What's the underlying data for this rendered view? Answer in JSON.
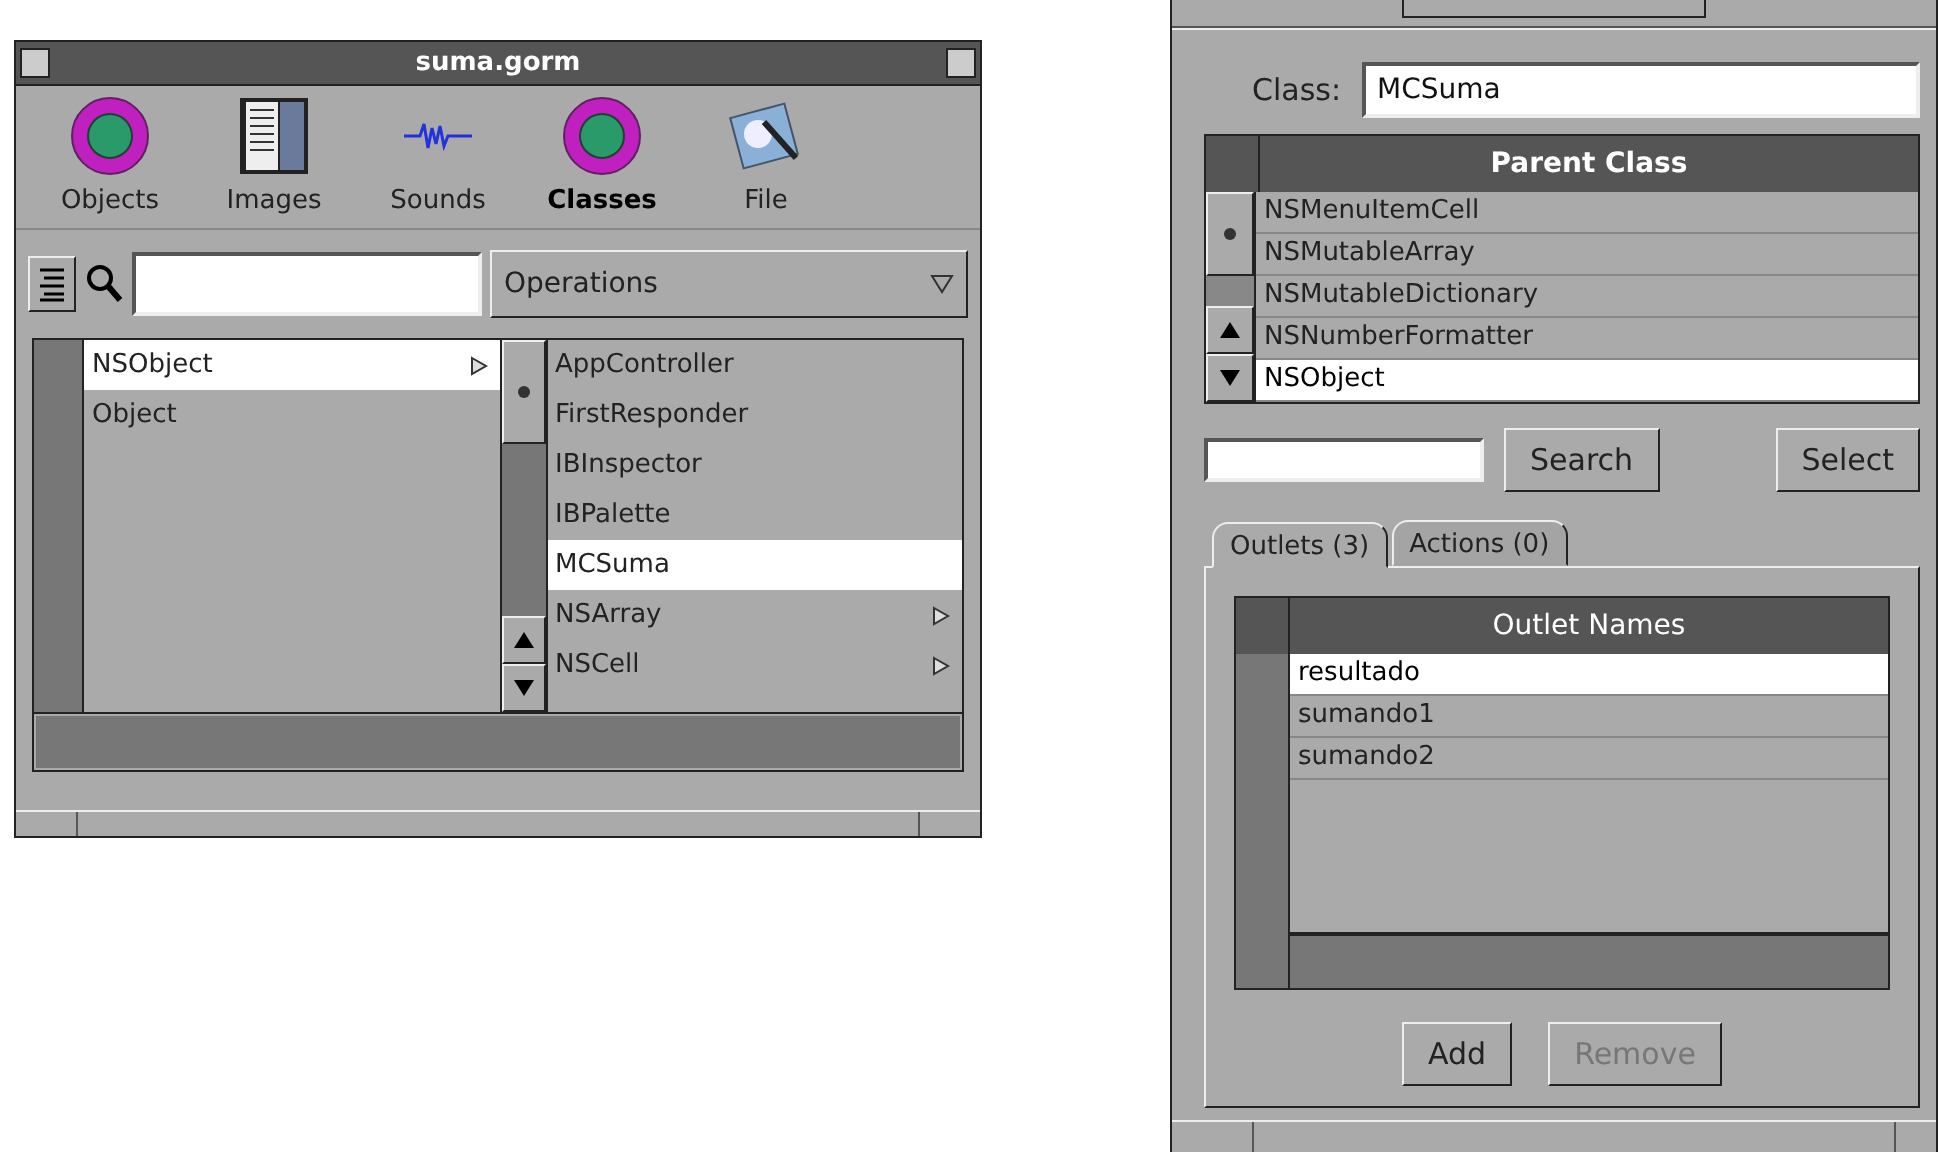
{
  "main_window": {
    "title": "suma.gorm",
    "toolbar": [
      {
        "label": "Objects",
        "kind": "objects",
        "selected": false
      },
      {
        "label": "Images",
        "kind": "images",
        "selected": false
      },
      {
        "label": "Sounds",
        "kind": "sounds",
        "selected": false
      },
      {
        "label": "Classes",
        "kind": "classes",
        "selected": true
      },
      {
        "label": "File",
        "kind": "file",
        "selected": false
      }
    ],
    "operations": {
      "value": "Operations"
    },
    "browser": {
      "column_1": [
        {
          "label": "NSObject",
          "has_children": true,
          "selected": true
        },
        {
          "label": "Object",
          "has_children": false,
          "selected": false
        }
      ],
      "column_2": [
        {
          "label": "AppController",
          "has_children": false,
          "selected": false
        },
        {
          "label": "FirstResponder",
          "has_children": false,
          "selected": false
        },
        {
          "label": "IBInspector",
          "has_children": false,
          "selected": false
        },
        {
          "label": "IBPalette",
          "has_children": false,
          "selected": false
        },
        {
          "label": "MCSuma",
          "has_children": false,
          "selected": true
        },
        {
          "label": "NSArray",
          "has_children": true,
          "selected": false
        },
        {
          "label": "NSCell",
          "has_children": true,
          "selected": false
        }
      ]
    }
  },
  "inspector": {
    "class_label": "Class:",
    "class_value": "MCSuma",
    "parent_table": {
      "header": "Parent Class",
      "rows": [
        {
          "label": "NSMenuItemCell",
          "selected": false
        },
        {
          "label": "NSMutableArray",
          "selected": false
        },
        {
          "label": "NSMutableDictionary",
          "selected": false
        },
        {
          "label": "NSNumberFormatter",
          "selected": false
        },
        {
          "label": "NSObject",
          "selected": true
        }
      ]
    },
    "search_button": "Search",
    "select_button": "Select",
    "tabs": [
      {
        "label": "Outlets (3)",
        "selected": true
      },
      {
        "label": "Actions (0)",
        "selected": false
      }
    ],
    "outlet_table": {
      "header": "Outlet Names",
      "rows": [
        {
          "label": "resultado",
          "selected": true
        },
        {
          "label": "sumando1",
          "selected": false
        },
        {
          "label": "sumando2",
          "selected": false
        }
      ]
    },
    "buttons": [
      {
        "label": "Add",
        "disabled": false
      },
      {
        "label": "Remove",
        "disabled": true
      }
    ]
  }
}
